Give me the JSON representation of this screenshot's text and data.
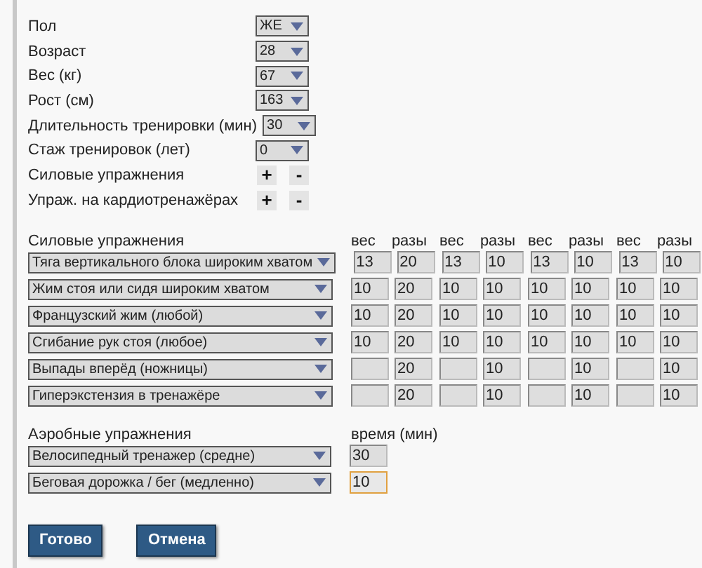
{
  "profile": [
    {
      "kind": "select",
      "label": "Пол",
      "value": "ЖЕ"
    },
    {
      "kind": "select",
      "label": "Возраст",
      "value": "28"
    },
    {
      "kind": "select",
      "label": "Вес (кг)",
      "value": "67"
    },
    {
      "kind": "select",
      "label": "Рост (см)",
      "value": "163"
    },
    {
      "kind": "select",
      "label": "Длительность тренировки (мин)",
      "value": "30"
    },
    {
      "kind": "select",
      "label": "Стаж тренировок (лет)",
      "value": "0"
    },
    {
      "kind": "plusminus",
      "label": "Силовые упражнения",
      "plus": "+",
      "minus": "-"
    },
    {
      "kind": "plusminus",
      "label": "Упраж. на кардиотренажёрах",
      "plus": "+",
      "minus": "-"
    }
  ],
  "strength": {
    "title": "Силовые упражнения",
    "headers": [
      {
        "weight": "вес",
        "reps": "разы"
      },
      {
        "weight": "вес",
        "reps": "разы"
      },
      {
        "weight": "вес",
        "reps": "разы"
      },
      {
        "weight": "вес",
        "reps": "разы"
      }
    ],
    "rows": [
      {
        "exercise": "Тяга вертикального блока широким хватом",
        "sets": [
          {
            "weight": "13",
            "reps": "20"
          },
          {
            "weight": "13",
            "reps": "10"
          },
          {
            "weight": "13",
            "reps": "10"
          },
          {
            "weight": "13",
            "reps": "10"
          }
        ]
      },
      {
        "exercise": "Жим стоя или сидя широким хватом",
        "sets": [
          {
            "weight": "10",
            "reps": "20"
          },
          {
            "weight": "10",
            "reps": "10"
          },
          {
            "weight": "10",
            "reps": "10"
          },
          {
            "weight": "10",
            "reps": "10"
          }
        ]
      },
      {
        "exercise": "Французский жим (любой)",
        "sets": [
          {
            "weight": "10",
            "reps": "20"
          },
          {
            "weight": "10",
            "reps": "10"
          },
          {
            "weight": "10",
            "reps": "10"
          },
          {
            "weight": "10",
            "reps": "10"
          }
        ]
      },
      {
        "exercise": "Сгибание рук стоя (любое)",
        "sets": [
          {
            "weight": "10",
            "reps": "20"
          },
          {
            "weight": "10",
            "reps": "10"
          },
          {
            "weight": "10",
            "reps": "10"
          },
          {
            "weight": "10",
            "reps": "10"
          }
        ]
      },
      {
        "exercise": "Выпады вперёд (ножницы)",
        "sets": [
          {
            "reps": "20"
          },
          {
            "reps": "10"
          },
          {
            "reps": "10"
          },
          {
            "reps": "10"
          }
        ]
      },
      {
        "exercise": "Гиперэкстензия в тренажёре",
        "sets": [
          {
            "reps": "20"
          },
          {
            "reps": "10"
          },
          {
            "reps": "10"
          },
          {
            "reps": "10"
          }
        ]
      }
    ]
  },
  "aerobic": {
    "title": "Аэробные упражнения",
    "time_header": "время (мин)",
    "rows": [
      {
        "exercise": "Велосипедный тренажер (средне)",
        "time": "30",
        "focused": false
      },
      {
        "exercise": "Беговая дорожка / бег (медленно)",
        "time": "10",
        "focused": true
      }
    ]
  },
  "buttons": [
    "Готово",
    "Отмена"
  ]
}
